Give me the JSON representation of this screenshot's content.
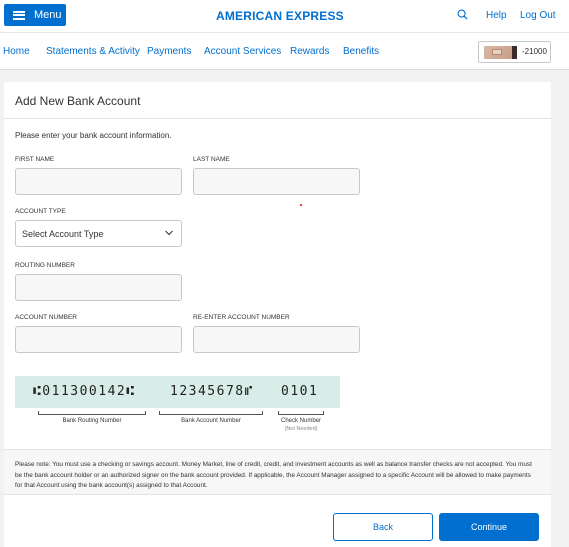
{
  "header": {
    "menu_label": "Menu",
    "brand": "AMERICAN EXPRESS",
    "help": "Help",
    "logout": "Log Out"
  },
  "nav": {
    "items": [
      "Home",
      "Statements & Activity",
      "Payments",
      "Account Services",
      "Rewards",
      "Benefits"
    ],
    "card_suffix": "-21000"
  },
  "form": {
    "title": "Add New Bank Account",
    "intro": "Please enter your bank account information.",
    "first_name_label": "FIRST NAME",
    "last_name_label": "LAST NAME",
    "account_type_label": "ACCOUNT TYPE",
    "account_type_value": "Select Account Type",
    "routing_label": "ROUTING NUMBER",
    "account_number_label": "ACCOUNT NUMBER",
    "reenter_label": "RE-ENTER ACCOUNT NUMBER",
    "first_name_value": "",
    "last_name_value": "",
    "routing_value": "",
    "account_number_value": "",
    "reenter_value": ""
  },
  "check_diagram": {
    "routing_digits": "⑆011300142⑆",
    "account_digits": "12345678⑈",
    "check_digits": "0101",
    "routing_caption": "Bank Routing Number",
    "account_caption": "Bank Account Number",
    "check_caption": "Check Number",
    "check_subcaption": "(Not Needed)"
  },
  "note": "Please note: You must use a checking or savings account. Money Market, line of credit, credit, and investment accounts as well as balance transfer checks are not accepted. You must be the bank account holder or an authorized signer on the bank account provided. If applicable, the Account Manager assigned to a specific Account will be allowed to make payments for that Account using the bank account(s) assigned to that Account.",
  "buttons": {
    "back": "Back",
    "continue": "Continue"
  },
  "colors": {
    "brand_blue": "#006fcf",
    "check_strip": "#d9ede8"
  }
}
